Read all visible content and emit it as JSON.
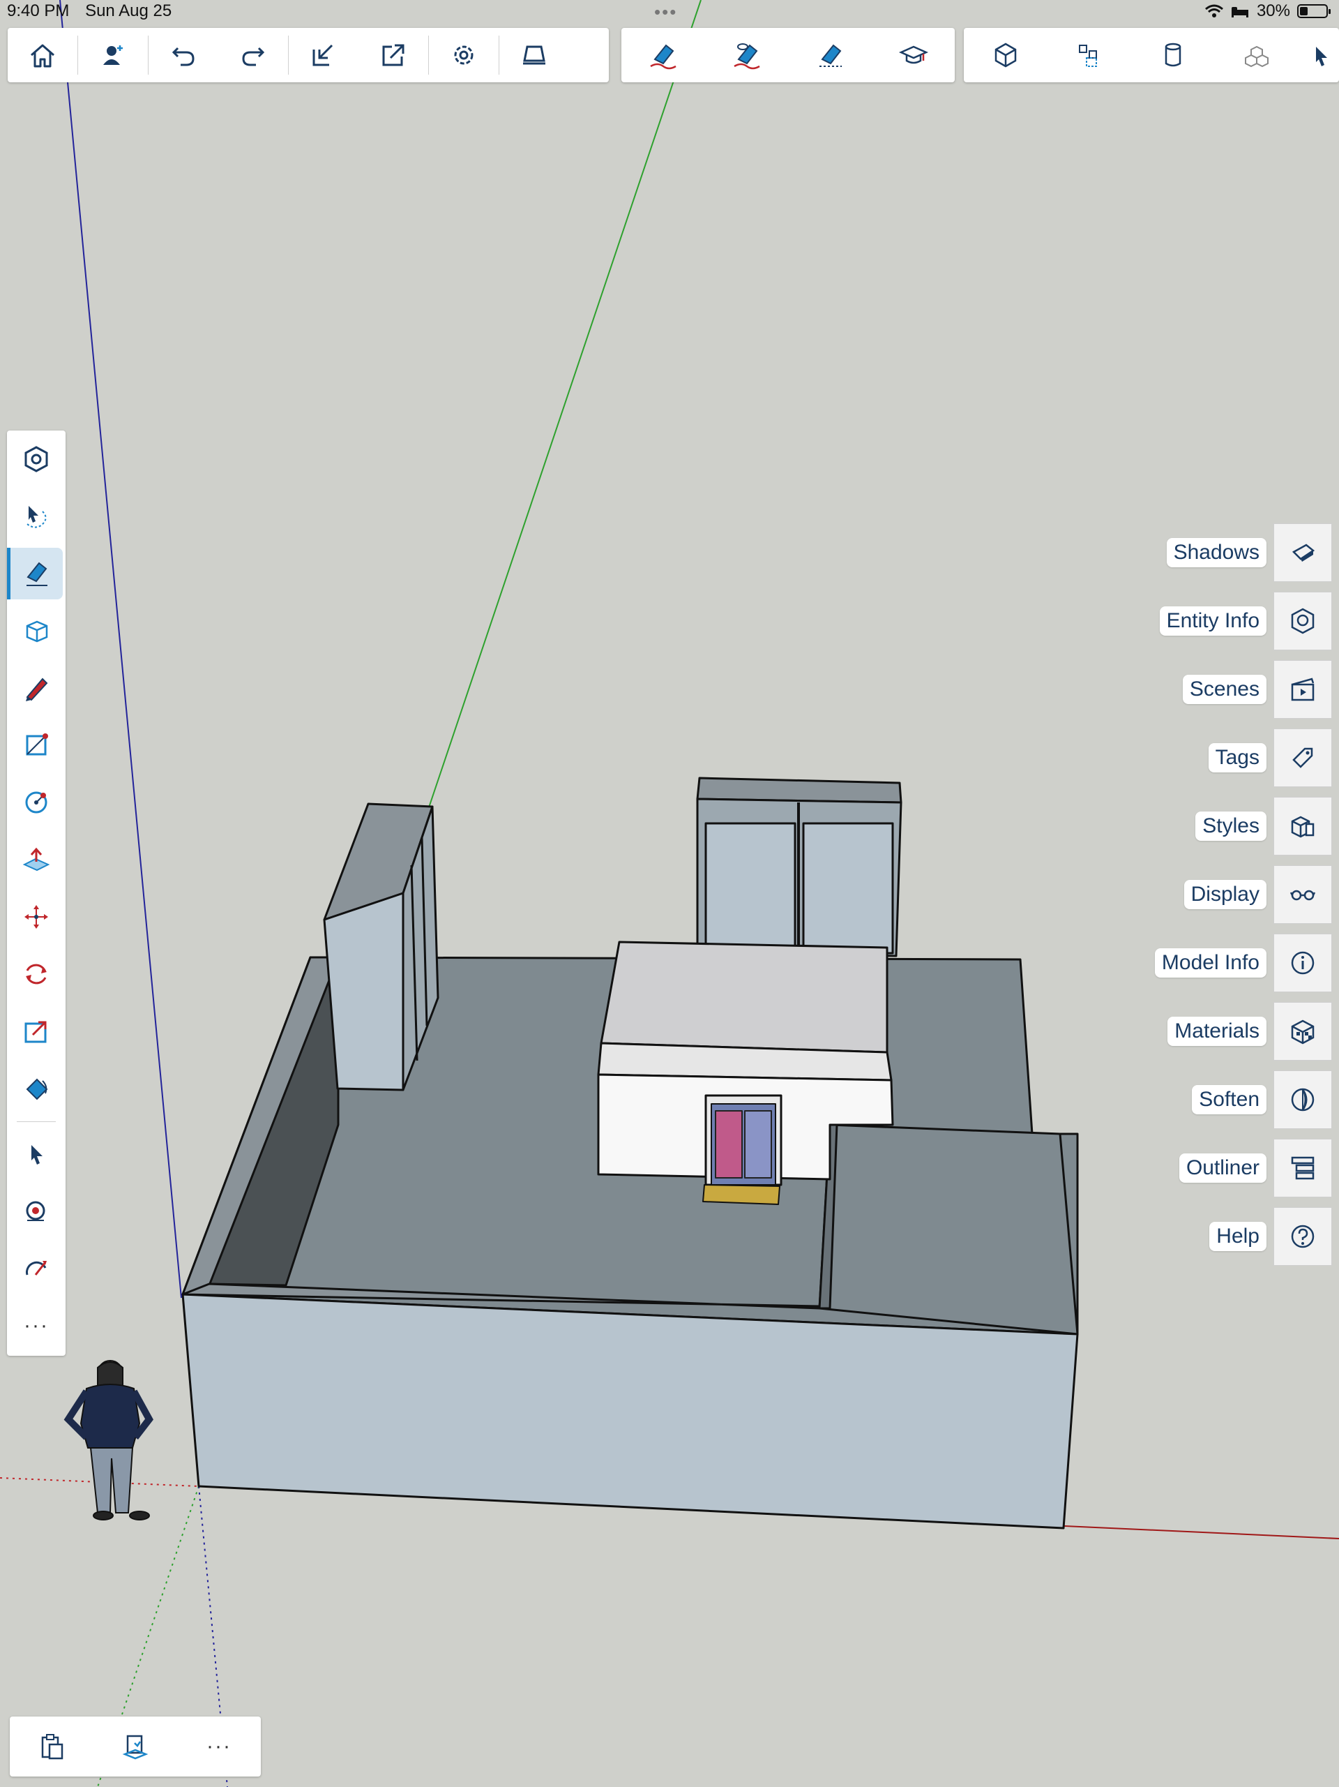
{
  "status_bar": {
    "time": "9:40 PM",
    "date": "Sun Aug 25",
    "battery": "30%",
    "battery_level": 0.3,
    "icons": [
      "wifi-icon",
      "sleep-icon",
      "battery-icon"
    ]
  },
  "top_toolbar": {
    "group1": [
      "home-icon",
      "add-user-icon",
      "undo-icon",
      "redo-icon",
      "import-icon",
      "export-icon",
      "settings-icon",
      "section-plane-icon"
    ],
    "group2": [
      "eraser-hide-icon",
      "eraser-visible-icon",
      "eraser-smooth-icon",
      "learn-icon"
    ],
    "group3": [
      "solid-box-icon",
      "components-icon",
      "cylinder-icon",
      "blocks-icon"
    ]
  },
  "left_toolbar": {
    "active_tool": "eraser",
    "tools": [
      "view-cube-icon",
      "orbit-select-icon",
      "eraser-icon",
      "box-select-icon",
      "pencil-icon",
      "rectangle-icon",
      "circle-icon",
      "push-pull-icon",
      "move-icon",
      "rotate-icon",
      "scale-icon",
      "paint-bucket-icon",
      "select-arrow-icon",
      "tape-measure-icon",
      "protractor-icon"
    ],
    "more_label": "···"
  },
  "right_panels": [
    {
      "label": "Shadows",
      "icon": "shadows-icon"
    },
    {
      "label": "Entity Info",
      "icon": "entity-info-icon"
    },
    {
      "label": "Scenes",
      "icon": "scenes-icon"
    },
    {
      "label": "Tags",
      "icon": "tags-icon"
    },
    {
      "label": "Styles",
      "icon": "styles-icon"
    },
    {
      "label": "Display",
      "icon": "display-icon"
    },
    {
      "label": "Model Info",
      "icon": "model-info-icon"
    },
    {
      "label": "Materials",
      "icon": "materials-icon"
    },
    {
      "label": "Soften",
      "icon": "soften-icon"
    },
    {
      "label": "Outliner",
      "icon": "outliner-icon"
    },
    {
      "label": "Help",
      "icon": "help-icon"
    }
  ],
  "bottom_bar": {
    "icons": [
      "clipboard-icon",
      "paste-in-place-icon"
    ],
    "more_label": "···"
  },
  "colors": {
    "viewport_bg": "#cfd0cb",
    "accent": "#1d86c9",
    "panel_text": "#1b3c63",
    "axis_red": "#c0262b",
    "axis_green": "#2ea12e",
    "axis_blue": "#23239a"
  }
}
